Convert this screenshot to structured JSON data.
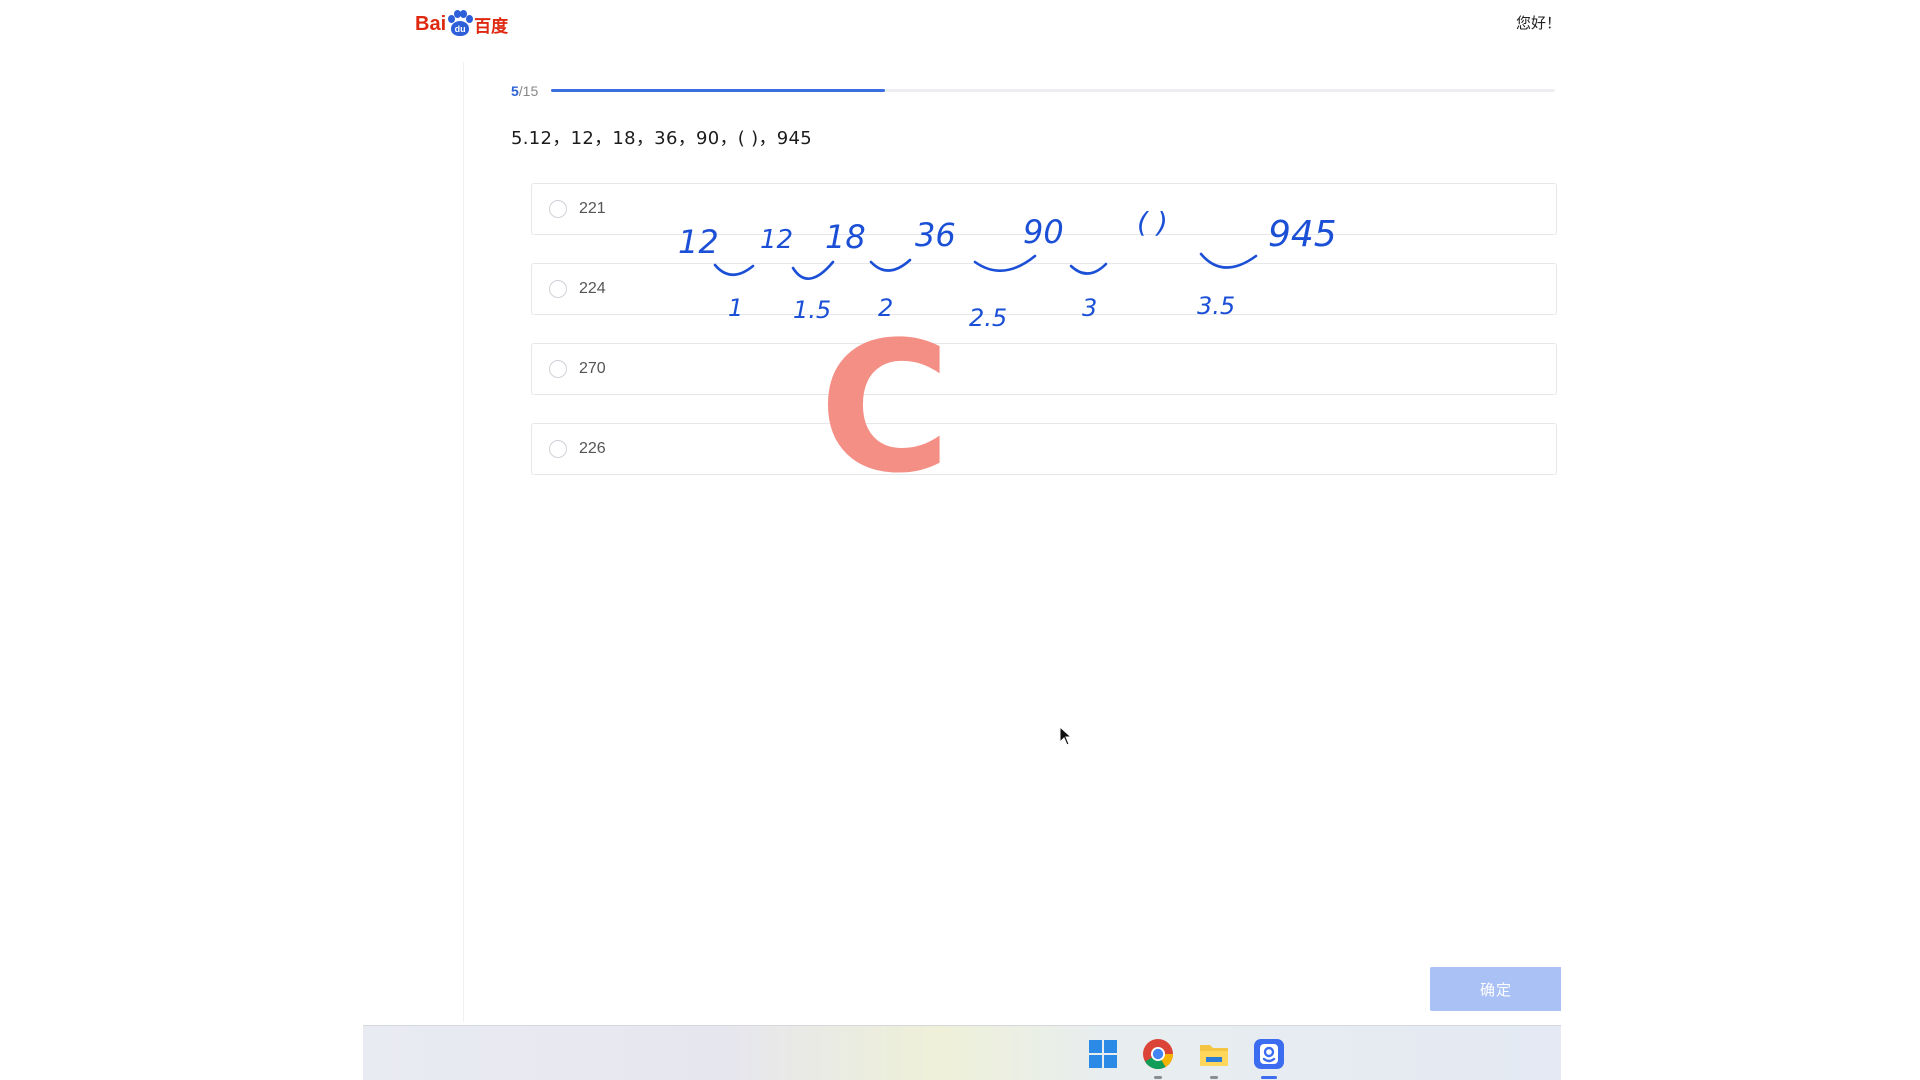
{
  "header": {
    "logo_latin": "Bai",
    "logo_paw_text": "du",
    "logo_chinese": "百度",
    "greeting": "您好！"
  },
  "progress": {
    "current": "5",
    "total": "/15",
    "fraction": 0.333
  },
  "question": {
    "text": "5.12，12，18，36，90，( )，945"
  },
  "options": [
    {
      "label": "221"
    },
    {
      "label": "224"
    },
    {
      "label": "270"
    },
    {
      "label": "226"
    }
  ],
  "confirm_label": "确定",
  "handwriting": {
    "sequence": [
      "12",
      "12",
      "18",
      "36",
      "90",
      "( )",
      "945"
    ],
    "ratios": [
      "1",
      "1.5",
      "2",
      "2.5",
      "3",
      "3.5"
    ],
    "answer_mark": "C"
  },
  "taskbar": {
    "icons": [
      "windows-start-icon",
      "chrome-icon",
      "file-explorer-icon",
      "pen-annotation-app-icon"
    ]
  },
  "colors": {
    "accent": "#3b6fe0",
    "button_disabled": "#a9c1f5",
    "ink_blue": "#1a4fd6",
    "ink_red": "#f48a7f",
    "logo_red": "#de2910",
    "logo_blue": "#2d60d8"
  }
}
